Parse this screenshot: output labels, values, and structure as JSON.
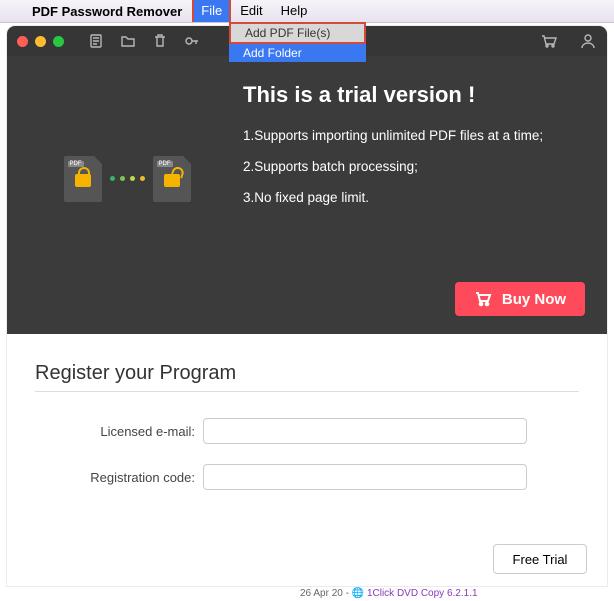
{
  "menubar": {
    "app_name": "PDF Password Remover",
    "items": {
      "file": "File",
      "edit": "Edit",
      "help": "Help"
    },
    "dropdown": {
      "add_files": "Add PDF File(s)",
      "add_folder": "Add Folder"
    }
  },
  "hero": {
    "title": "This is a trial version !",
    "line1": "1.Supports importing unlimited PDF files at a time;",
    "line2": "2.Supports batch processing;",
    "line3": "3.No fixed page limit.",
    "pdf_tag": "PDF",
    "buy_label": "Buy Now"
  },
  "register": {
    "heading": "Register your Program",
    "email_label": "Licensed e-mail:",
    "code_label": "Registration code:",
    "email_value": "",
    "code_value": "",
    "free_trial": "Free Trial"
  },
  "colors": {
    "accent": "#ff4a5c",
    "menu_blue": "#3a78f2",
    "highlight_red": "#d34a3a",
    "dots": [
      "#35b56a",
      "#7bc94f",
      "#c2d84a",
      "#f0b92f"
    ]
  },
  "footer_peek": {
    "date": "26 Apr 20 - ",
    "link": "1Click DVD Copy 6.2.1.1"
  }
}
